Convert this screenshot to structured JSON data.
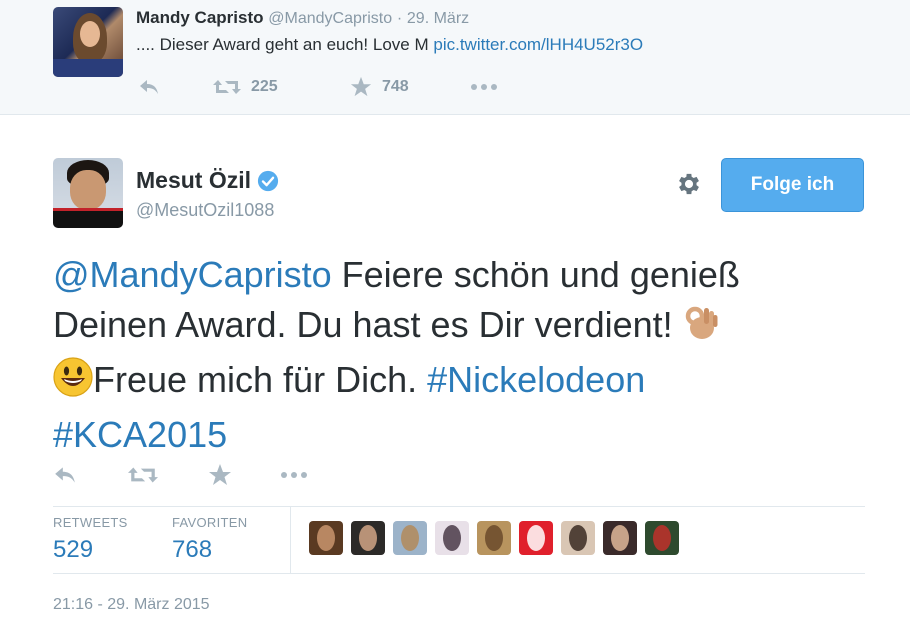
{
  "parent_tweet": {
    "name": "Mandy Capristo",
    "handle": "@MandyCapristo",
    "separator": "·",
    "date": "29. März",
    "text": ".... Dieser Award geht an euch! Love M ",
    "link": "pic.twitter.com/lHH4U52r3O",
    "actions": {
      "reply_icon": "reply-icon",
      "retweet_icon": "retweet-icon",
      "retweet_count": "225",
      "favorite_icon": "star-icon",
      "favorite_count": "748",
      "more_icon": "more-icon"
    }
  },
  "tweet": {
    "author_name": "Mesut Özil",
    "author_handle": "@MesutOzil1088",
    "verified_icon": "verified-badge-icon",
    "follow_label": "Folge ich",
    "text_parts": {
      "mention": "@MandyCapristo",
      "line1_rest": " Feiere schön und genieß",
      "line2": "Deinen Award. Du hast es Dir verdient! ",
      "line3_text": "Freue mich für Dich. ",
      "hashtag1": "#Nickelodeon",
      "hashtag2": "#KCA2015"
    },
    "emojis": [
      "ok-hand-emoji",
      "smiley-emoji"
    ],
    "stats": {
      "retweets_label": "RETWEETS",
      "retweets_value": "529",
      "favorites_label": "FAVORITEN",
      "favorites_value": "768"
    },
    "favoriter_avatars": [
      {
        "name": "favoriter-avatar-1",
        "bg": "#5a3a22",
        "fg": "#c9956d"
      },
      {
        "name": "favoriter-avatar-2",
        "bg": "#2c2a28",
        "fg": "#d1a585"
      },
      {
        "name": "favoriter-avatar-3",
        "bg": "#9cb3c9",
        "fg": "#b38a5a"
      },
      {
        "name": "favoriter-avatar-4",
        "bg": "#e8e0e8",
        "fg": "#4a3a48"
      },
      {
        "name": "favoriter-avatar-5",
        "bg": "#b8945e",
        "fg": "#6a4a2a"
      },
      {
        "name": "favoriter-avatar-6",
        "bg": "#e0202c",
        "fg": "#ffffff"
      },
      {
        "name": "favoriter-avatar-7",
        "bg": "#d9c6b4",
        "fg": "#3a2a22"
      },
      {
        "name": "favoriter-avatar-8",
        "bg": "#3a2a2a",
        "fg": "#e0b89a"
      },
      {
        "name": "favoriter-avatar-9",
        "bg": "#2e4a2e",
        "fg": "#c0302a"
      }
    ],
    "timestamp": "21:16 - 29. März 2015"
  },
  "colors": {
    "link": "#2b7bb9",
    "follow_button": "#55acee",
    "muted": "#8899a6",
    "icon": "#aab8c2"
  }
}
